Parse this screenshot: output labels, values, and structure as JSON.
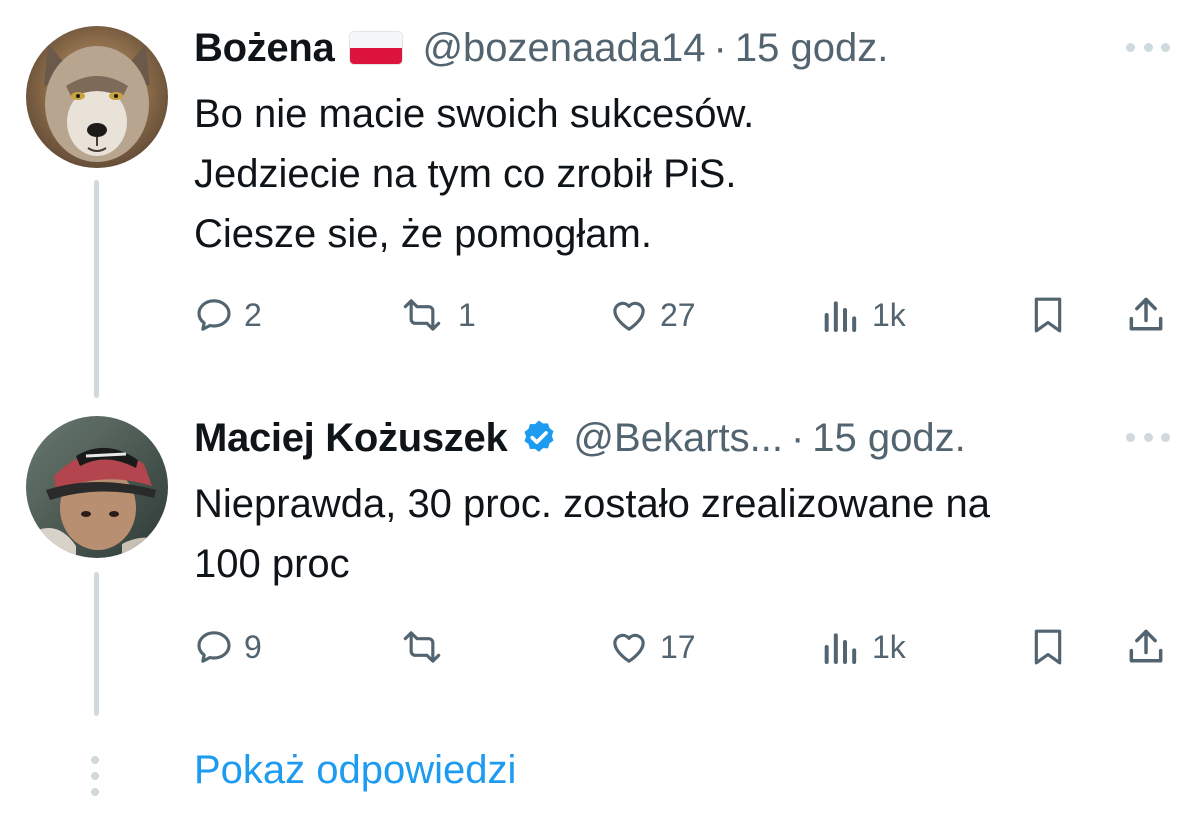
{
  "thread": {
    "tweets": [
      {
        "author": {
          "name": "Bożena",
          "flag_icon": "poland-flag-icon",
          "handle": "@bozenaada14",
          "avatar": "wolf-avatar"
        },
        "time": "15 godz.",
        "separator": "·",
        "text_lines": [
          "Bo nie macie swoich sukcesów.",
          "Jedziecie na tym co zrobił PiS.",
          "Ciesze sie, że pomogłam."
        ],
        "stats": {
          "replies": "2",
          "retweets": "1",
          "likes": "27",
          "views": "1k"
        }
      },
      {
        "author": {
          "name": "Maciej Kożuszek",
          "verified_icon": "verified-badge-icon",
          "handle": "@Bekarts...",
          "avatar": "person-cap-avatar"
        },
        "time": "15 godz.",
        "separator": "·",
        "text_lines": [
          "Nieprawda, 30 proc. zostało zrealizowane na",
          "100 proc"
        ],
        "stats": {
          "replies": "9",
          "retweets": "",
          "likes": "17",
          "views": "1k"
        }
      }
    ],
    "show_replies_label": "Pokaż odpowiedzi"
  },
  "colors": {
    "text_primary": "#0f1419",
    "text_secondary": "#536471",
    "accent": "#1d9bf0",
    "thread_line": "#cfd9de",
    "verified": "#1d9bf0",
    "flag_red": "#dc143c"
  }
}
